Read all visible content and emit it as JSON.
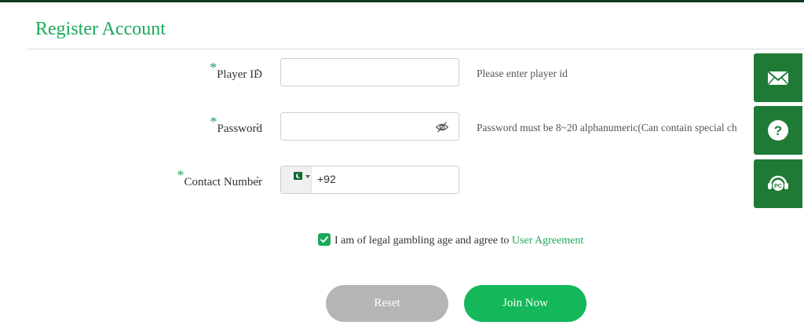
{
  "page": {
    "title": "Register Account"
  },
  "form": {
    "required_mark": "*",
    "colon": ":",
    "player_id": {
      "label": "Player ID",
      "value": "",
      "hint": "Please enter player id"
    },
    "password": {
      "label": "Password",
      "value": "",
      "hint": "Password must be 8~20 alphanumeric(Can contain special ch"
    },
    "contact": {
      "label": "Contact Number",
      "country": "Pakistan",
      "dial_code": "+92"
    }
  },
  "agreement": {
    "checked": true,
    "text": "I am of legal gambling age and agree to",
    "link": "User Agreement"
  },
  "buttons": {
    "reset": "Reset",
    "join": "Join Now"
  },
  "side_tools": [
    {
      "icon": "mail-icon"
    },
    {
      "icon": "help-icon"
    },
    {
      "icon": "pc-support-icon"
    }
  ],
  "colors": {
    "accent": "#1aa95a",
    "sidebar": "#1e7a35",
    "reset": "#b5b5b5",
    "join": "#14b85a"
  }
}
